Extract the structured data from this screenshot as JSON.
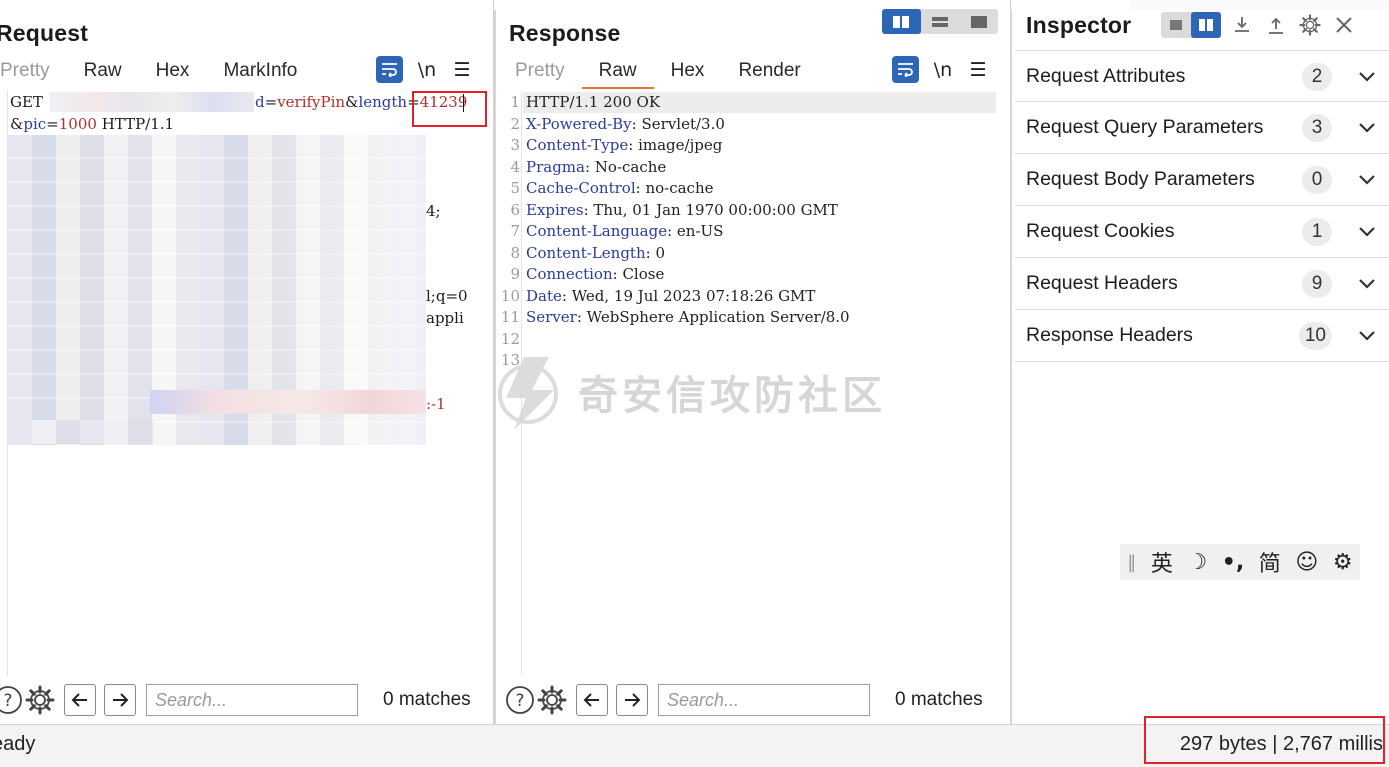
{
  "request": {
    "title": "Request",
    "tabs": [
      "Pretty",
      "Raw",
      "Hex",
      "MarkInfo"
    ],
    "active_tab": "Raw",
    "newline_label": "\\n",
    "menu_label": "☰",
    "lines": {
      "l1_method": "GET ",
      "l1_param_d": "d",
      "l1_eq1": "=",
      "l1_val1": "verifyPin",
      "l1_amp1": "&",
      "l1_param_length": "length",
      "l1_eq2": "=",
      "l1_val_length": "41239",
      "l2_amp": "&",
      "l2_param_pic": "pic",
      "l2_eq": "=",
      "l2_val_pic": "1000",
      "l2_proto": " HTTP/1.1",
      "frag_a": "4;",
      "frag_b": "l;q=0",
      "frag_c": "appli",
      "frag_d": ":-1"
    },
    "search_placeholder": "Search...",
    "matches": "0 matches"
  },
  "response": {
    "title": "Response",
    "tabs": [
      "Pretty",
      "Raw",
      "Hex",
      "Render"
    ],
    "active_tab": "Raw",
    "newline_label": "\\n",
    "menu_label": "☰",
    "lines": [
      {
        "num": "1",
        "key": "",
        "val": "HTTP/1.1 200 OK"
      },
      {
        "num": "2",
        "key": "X-Powered-By",
        "val": ": Servlet/3.0"
      },
      {
        "num": "3",
        "key": "Content-Type",
        "val": ": image/jpeg"
      },
      {
        "num": "4",
        "key": "Pragma",
        "val": ": No-cache"
      },
      {
        "num": "5",
        "key": "Cache-Control",
        "val": ": no-cache"
      },
      {
        "num": "6",
        "key": "Expires",
        "val": ": Thu, 01 Jan 1970 00:00:00 GMT"
      },
      {
        "num": "7",
        "key": "Content-Language",
        "val": ": en-US"
      },
      {
        "num": "8",
        "key": "Content-Length",
        "val": ": 0"
      },
      {
        "num": "9",
        "key": "Connection",
        "val": ": Close"
      },
      {
        "num": "10",
        "key": "Date",
        "val": ": Wed, 19 Jul 2023 07:18:26 GMT"
      },
      {
        "num": "11",
        "key": "Server",
        "val": ": WebSphere Application Server/8.0"
      },
      {
        "num": "12",
        "key": "",
        "val": ""
      },
      {
        "num": "13",
        "key": "",
        "val": ""
      }
    ],
    "search_placeholder": "Search...",
    "matches": "0 matches"
  },
  "inspector": {
    "title": "Inspector",
    "sections": [
      {
        "label": "Request Attributes",
        "count": "2"
      },
      {
        "label": "Request Query Parameters",
        "count": "3"
      },
      {
        "label": "Request Body Parameters",
        "count": "0"
      },
      {
        "label": "Request Cookies",
        "count": "1"
      },
      {
        "label": "Request Headers",
        "count": "9"
      },
      {
        "label": "Response Headers",
        "count": "10"
      }
    ]
  },
  "ime": {
    "sep": "‖",
    "lang": "英",
    "moon": "☽",
    "punct": "•,",
    "simp": "简",
    "smile": "☺",
    "gear": "⚙"
  },
  "watermark": {
    "text": "奇安信攻防社区"
  },
  "status": {
    "left": "eady",
    "right": "297 bytes | 2,767 millis"
  },
  "colors": {
    "accent": "#2d66b7",
    "tab_underline": "#e8713a",
    "annotation": "#e0202a",
    "header_key": "#2b3c9f",
    "param_value": "#b52d2d"
  }
}
